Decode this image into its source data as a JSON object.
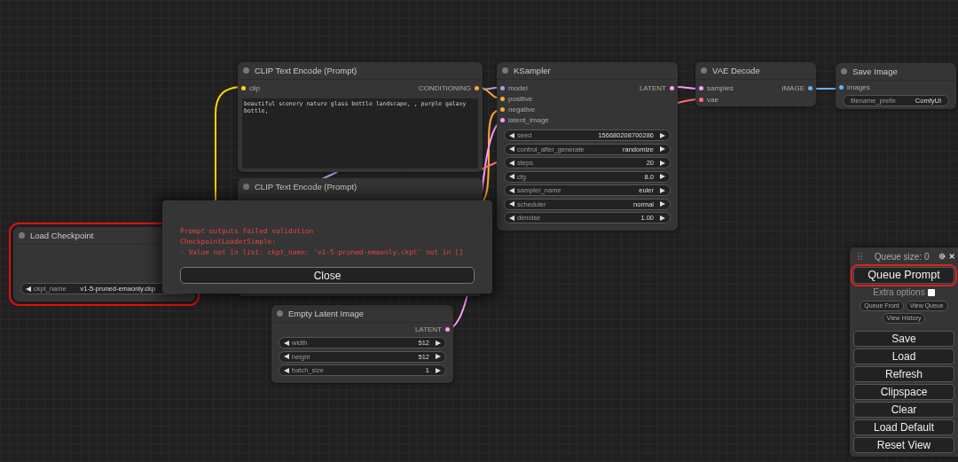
{
  "nodes": [
    {
      "title": "CLIP Text Encode (Prompt)",
      "error": false,
      "inputs": [
        {
          "name": "clip",
          "color": "#ffd500"
        }
      ],
      "outputs": [
        {
          "name": "CONDITIONING",
          "color": "#ffa931"
        }
      ],
      "text": "beautiful scenery nature glass bottle landscape, , purple galaxy bottle,"
    },
    {
      "title": "CLIP Text Encode (Prompt)",
      "error": false
    },
    {
      "title": "KSampler",
      "error": false,
      "inputs": [
        {
          "name": "model",
          "color": "#b39ddb"
        },
        {
          "name": "positive",
          "color": "#ffa931"
        },
        {
          "name": "negative",
          "color": "#ffa931"
        },
        {
          "name": "latent_image",
          "color": "#ff9cf9"
        }
      ],
      "outputs": [
        {
          "name": "LATENT",
          "color": "#ff9cf9"
        }
      ],
      "widgets": [
        {
          "label": "seed",
          "value": "156680208700286",
          "kind": "stepper"
        },
        {
          "label": "control_after_generate",
          "value": "randomize",
          "kind": "stepper"
        },
        {
          "label": "steps",
          "value": "20",
          "kind": "stepper"
        },
        {
          "label": "cfg",
          "value": "8.0",
          "kind": "stepper"
        },
        {
          "label": "sampler_name",
          "value": "euler",
          "kind": "stepper"
        },
        {
          "label": "scheduler",
          "value": "normal",
          "kind": "stepper"
        },
        {
          "label": "denoise",
          "value": "1.00",
          "kind": "stepper"
        }
      ]
    },
    {
      "title": "VAE Decode",
      "error": false,
      "inputs": [
        {
          "name": "samples",
          "color": "#ff9cf9"
        },
        {
          "name": "vae",
          "color": "#ff6e6e"
        }
      ],
      "outputs": [
        {
          "name": "IMAGE",
          "color": "#64b5f6"
        }
      ]
    },
    {
      "title": "Save Image",
      "error": false,
      "inputs": [
        {
          "name": "images",
          "color": "#64b5f6"
        }
      ],
      "widgets": [
        {
          "label": "filename_prefix",
          "value": "ComfyUI",
          "kind": "text"
        }
      ]
    },
    {
      "title": "Load Checkpoint",
      "error": true,
      "widgets": [
        {
          "label": "ckpt_name",
          "value": "v1-5-pruned-emaonly.ckp",
          "kind": "cut"
        }
      ]
    },
    {
      "title": "Empty Latent Image",
      "error": false,
      "outputs": [
        {
          "name": "LATENT",
          "color": "#ff9cf9"
        }
      ],
      "widgets": [
        {
          "label": "width",
          "value": "512",
          "kind": "stepper"
        },
        {
          "label": "height",
          "value": "512",
          "kind": "stepper"
        },
        {
          "label": "batch_size",
          "value": "1",
          "kind": "stepper"
        }
      ]
    }
  ],
  "dialog": {
    "lines": [
      "Prompt outputs failed validation",
      "CheckpointLoaderSimple:",
      "- Value not in list: ckpt_name: 'v1-5-pruned-emaonly.ckpt' not in []"
    ],
    "button": "Close"
  },
  "queue_panel": {
    "title": "Queue size: 0",
    "queue_button": {
      "label": "Queue Prompt",
      "highlighted": true
    },
    "extra_options": {
      "label": "Extra options",
      "checked": false
    },
    "small_buttons": [
      "Queue Front",
      "View Queue",
      "View History"
    ],
    "buttons": [
      "Save",
      "Load",
      "Refresh",
      "Clipspace",
      "Clear",
      "Load Default",
      "Reset View"
    ]
  }
}
